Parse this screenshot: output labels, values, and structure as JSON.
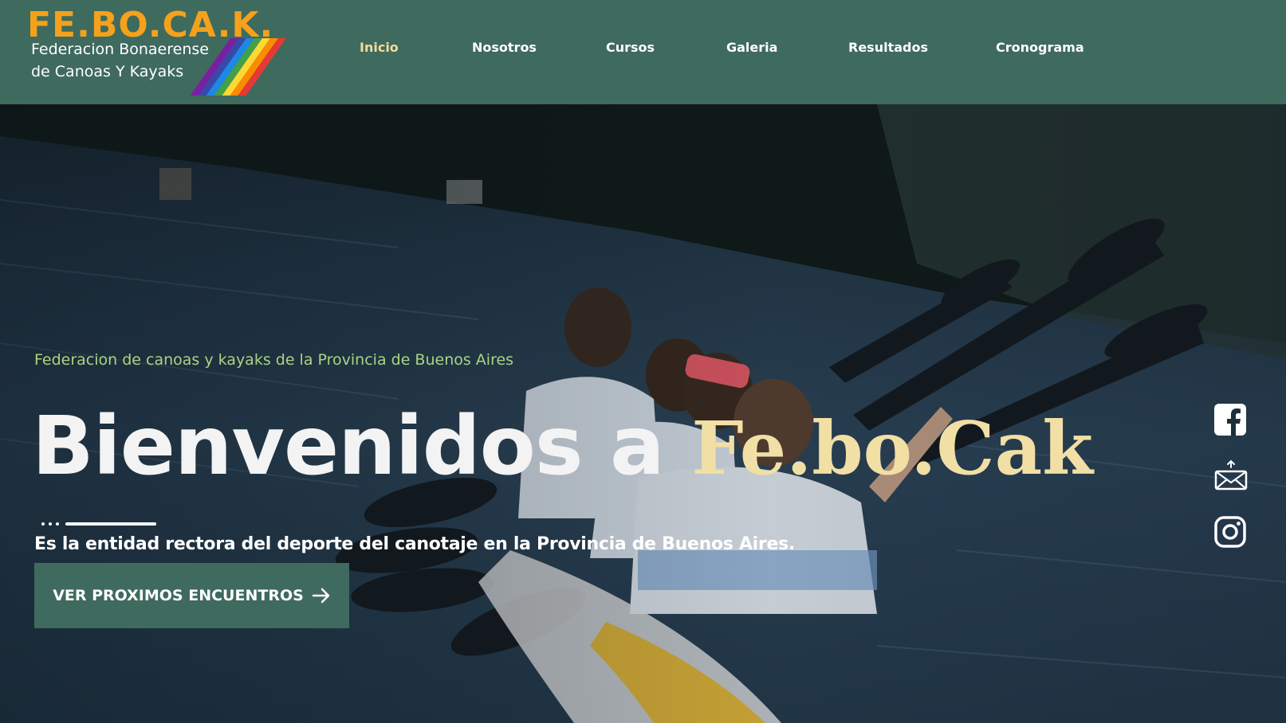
{
  "header": {
    "logo": {
      "title": "FE.BO.CA.K.",
      "line1": "Federacion Bonaerense",
      "line2": "de Canoas Y Kayaks"
    },
    "nav": [
      {
        "label": "Inicio",
        "active": true
      },
      {
        "label": "Nosotros",
        "active": false
      },
      {
        "label": "Cursos",
        "active": false
      },
      {
        "label": "Galeria",
        "active": false
      },
      {
        "label": "Resultados",
        "active": false
      },
      {
        "label": "Cronograma",
        "active": false
      }
    ]
  },
  "hero": {
    "subtitle": "Federacion de canoas y kayaks de la Provincia de Buenos Aires",
    "title_part1": "Bienvenidos a ",
    "title_part2": "Fe.bo.Cak",
    "tagline": "Es la entidad rectora del deporte del canotaje en la Provincia de Buenos Aires.",
    "cta_label": "VER PROXIMOS ENCUENTROS",
    "cta_icon": "arrow-right-icon"
  },
  "social": [
    {
      "icon": "facebook-icon"
    },
    {
      "icon": "email-icon"
    },
    {
      "icon": "instagram-icon"
    }
  ],
  "colors": {
    "header_bg": "#3f6a5e",
    "nav_active": "#f3dd9a",
    "logo_orange": "#f5a11c",
    "subtitle_green": "#a9d483",
    "title_accent": "#f1dfa5",
    "cta_bg": "#3f6a5e"
  }
}
